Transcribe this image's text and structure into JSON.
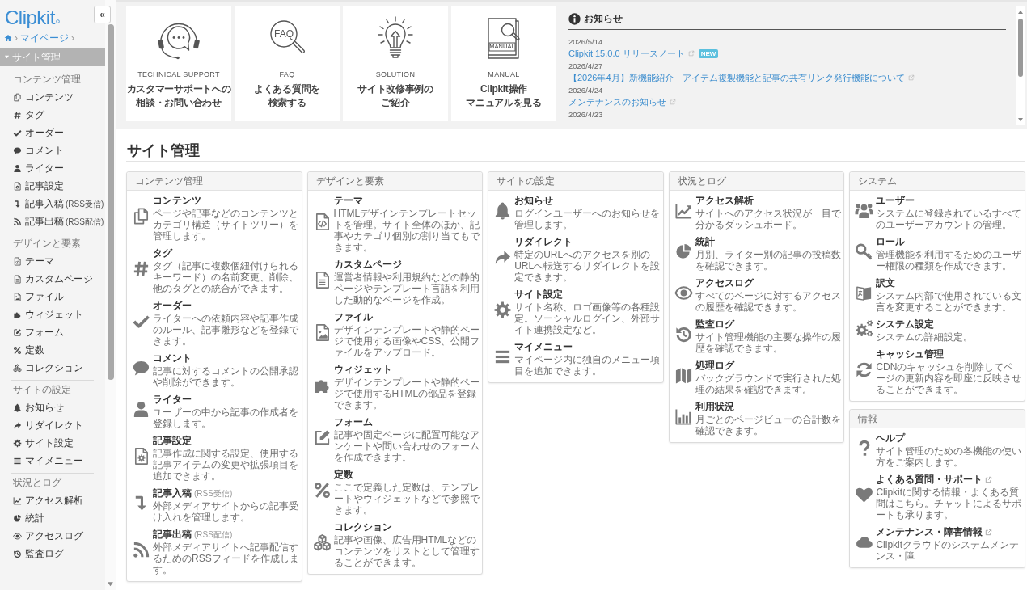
{
  "sidebar": {
    "logo": "Clipkit",
    "collapse_button": "«",
    "breadcrumb": [
      {
        "kind": "home"
      },
      {
        "kind": "separator",
        "text": "›"
      },
      {
        "kind": "link",
        "text": "マイページ"
      },
      {
        "kind": "separator",
        "text": "›"
      }
    ],
    "nav": [
      {
        "label": "サイト管理",
        "selected": true,
        "expanded": true
      }
    ],
    "groups": [
      {
        "title": "コンテンツ管理",
        "items": [
          {
            "label": "コンテンツ"
          },
          {
            "label": "タグ"
          },
          {
            "label": "オーダー"
          },
          {
            "label": "コメント"
          },
          {
            "label": "ライター"
          },
          {
            "label": "記事設定"
          },
          {
            "label": "記事入稿",
            "note": "(RSS受信)"
          },
          {
            "label": "記事出稿",
            "note": "(RSS配信)"
          }
        ]
      },
      {
        "title": "デザインと要素",
        "items": [
          {
            "label": "テーマ"
          },
          {
            "label": "カスタムページ"
          },
          {
            "label": "ファイル"
          },
          {
            "label": "ウィジェット"
          },
          {
            "label": "フォーム"
          },
          {
            "label": "定数"
          },
          {
            "label": "コレクション"
          }
        ]
      },
      {
        "title": "サイトの設定",
        "items": [
          {
            "label": "お知らせ"
          },
          {
            "label": "リダイレクト"
          },
          {
            "label": "サイト設定"
          },
          {
            "label": "マイメニュー"
          }
        ]
      },
      {
        "title": "状況とログ",
        "items": [
          {
            "label": "アクセス解析"
          },
          {
            "label": "統計"
          },
          {
            "label": "アクセスログ"
          },
          {
            "label": "監査ログ"
          }
        ]
      }
    ]
  },
  "quick_links": [
    {
      "label": "TECHNICAL SUPPORT",
      "lines": [
        "カスタマーサポートへの",
        "相談・お問い合わせ"
      ]
    },
    {
      "label": "FAQ",
      "icon_text": "FAQ",
      "lines": [
        "よくある質問を",
        "検索する"
      ]
    },
    {
      "label": "SOLUTION",
      "lines": [
        "サイト改修事例の",
        "ご紹介"
      ]
    },
    {
      "label": "MANUAL",
      "icon_text": "MANUAL",
      "lines": [
        "Clipkit操作",
        "マニュアルを見る"
      ]
    }
  ],
  "news": {
    "title": "お知らせ",
    "items": [
      {
        "date": "2026/5/14",
        "title": "Clipkit 15.0.0 リリースノート",
        "external": true,
        "badge": "NEW"
      },
      {
        "date": "2026/4/27",
        "title": "【2026年4月】新機能紹介｜アイテム複製機能と記事の共有リンク発行機能について",
        "external": true
      },
      {
        "date": "2026/4/24",
        "title": "メンテナンスのお知らせ",
        "external": true
      },
      {
        "date": "2026/4/23"
      }
    ]
  },
  "page": {
    "title": "サイト管理",
    "columns": [
      {
        "panels": [
          {
            "title": "コンテンツ管理",
            "items": [
              {
                "title": "コンテンツ",
                "description": "ページや記事などのコンテンツとカテゴリ構造（サイトツリー）を管理します。"
              },
              {
                "title": "タグ",
                "description": "タグ（記事に複数個紐付けられるキーワード）の名前変更、削除、他のタグとの統合ができます。"
              },
              {
                "title": "オーダー",
                "description": "ライターへの依頼内容や記事作成のルール、記事雛形などを登録できます。"
              },
              {
                "title": "コメント",
                "description": "記事に対するコメントの公開承認や削除ができます。"
              },
              {
                "title": "ライター",
                "description": "ユーザーの中から記事の作成者を登録します。"
              },
              {
                "title": "記事設定",
                "description": "記事作成に関する設定、使用する記事アイテムの変更や拡張項目を追加できます。"
              },
              {
                "title": "記事入稿",
                "note": "(RSS受信)",
                "description": "外部メディアサイトからの記事受け入れを管理します。"
              },
              {
                "title": "記事出稿",
                "note": "(RSS配信)",
                "description": "外部メディアサイトへ記事配信するためのRSSフィードを作成します。"
              }
            ]
          }
        ]
      },
      {
        "panels": [
          {
            "title": "デザインと要素",
            "items": [
              {
                "title": "テーマ",
                "description": "HTMLデザインテンプレートセットを管理。サイト全体のほか、記事やカテゴリ個別の割り当てもできます。"
              },
              {
                "title": "カスタムページ",
                "description": "運営者情報や利用規約などの静的ページやテンプレート言語を利用した動的なページを作成。"
              },
              {
                "title": "ファイル",
                "description": "デザインテンプレートや静的ページで使用する画像やCSS、公開ファイルをアップロード。"
              },
              {
                "title": "ウィジェット",
                "description": "デザインテンプレートや静的ページで使用するHTMLの部品を登録できます。"
              },
              {
                "title": "フォーム",
                "description": "記事や固定ページに配置可能なアンケートや問い合わせのフォームを作成できます。"
              },
              {
                "title": "定数",
                "description": "ここで定義した定数は、テンプレートやウィジェットなどで参照できます。"
              },
              {
                "title": "コレクション",
                "description": "記事や画像、広告用HTMLなどのコンテンツをリストとして管理することができます。"
              }
            ]
          }
        ]
      },
      {
        "panels": [
          {
            "title": "サイトの設定",
            "items": [
              {
                "title": "お知らせ",
                "description": "ログインユーザーへのお知らせを管理します。"
              },
              {
                "title": "リダイレクト",
                "description": "特定のURLへのアクセスを別のURLへ転送するリダイレクトを設定できます。"
              },
              {
                "title": "サイト設定",
                "description": "サイト名称、ロゴ画像等の各種設定。ソーシャルログイン、外部サイト連携設定など。"
              },
              {
                "title": "マイメニュー",
                "description": "マイページ内に独自のメニュー項目を追加できます。"
              }
            ]
          }
        ]
      },
      {
        "panels": [
          {
            "title": "状況とログ",
            "items": [
              {
                "title": "アクセス解析",
                "description": "サイトへのアクセス状況が一目で分かるダッシュボード。"
              },
              {
                "title": "統計",
                "description": "月別、ライター別の記事の投稿数を確認できます。"
              },
              {
                "title": "アクセスログ",
                "description": "すべてのページに対するアクセスの履歴を確認できます。"
              },
              {
                "title": "監査ログ",
                "description": "サイト管理機能の主要な操作の履歴を確認できます。"
              },
              {
                "title": "処理ログ",
                "description": "バックグラウンドで実行された処理の結果を確認できます。"
              },
              {
                "title": "利用状況",
                "description": "月ごとのページビューの合計数を確認できます。"
              }
            ]
          }
        ]
      },
      {
        "panels": [
          {
            "title": "システム",
            "items": [
              {
                "title": "ユーザー",
                "description": "システムに登録されているすべてのユーザーアカウントの管理。"
              },
              {
                "title": "ロール",
                "description": "管理機能を利用するためのユーザー権限の種類を作成できます。"
              },
              {
                "title": "訳文",
                "description": "システム内部で使用されている文言を変更することができます。"
              },
              {
                "title": "システム設定",
                "description": "システムの詳細設定。"
              },
              {
                "title": "キャッシュ管理",
                "description": "CDNのキャッシュを削除してページの更新内容を即座に反映させることができます。"
              }
            ]
          },
          {
            "title": "情報",
            "items": [
              {
                "title": "ヘルプ",
                "external": false,
                "description": "サイト管理のための各機能の使い方をご案内します。"
              },
              {
                "title": "よくある質問・サポート",
                "external": true,
                "description": "Clipkitに関する情報・よくある質問はこちら。チャットによるサポートも承ります。"
              },
              {
                "title": "メンテナンス・障害情報",
                "external": true,
                "description": "Clipkitクラウドのシステムメンテンス・障"
              }
            ]
          }
        ]
      }
    ]
  }
}
